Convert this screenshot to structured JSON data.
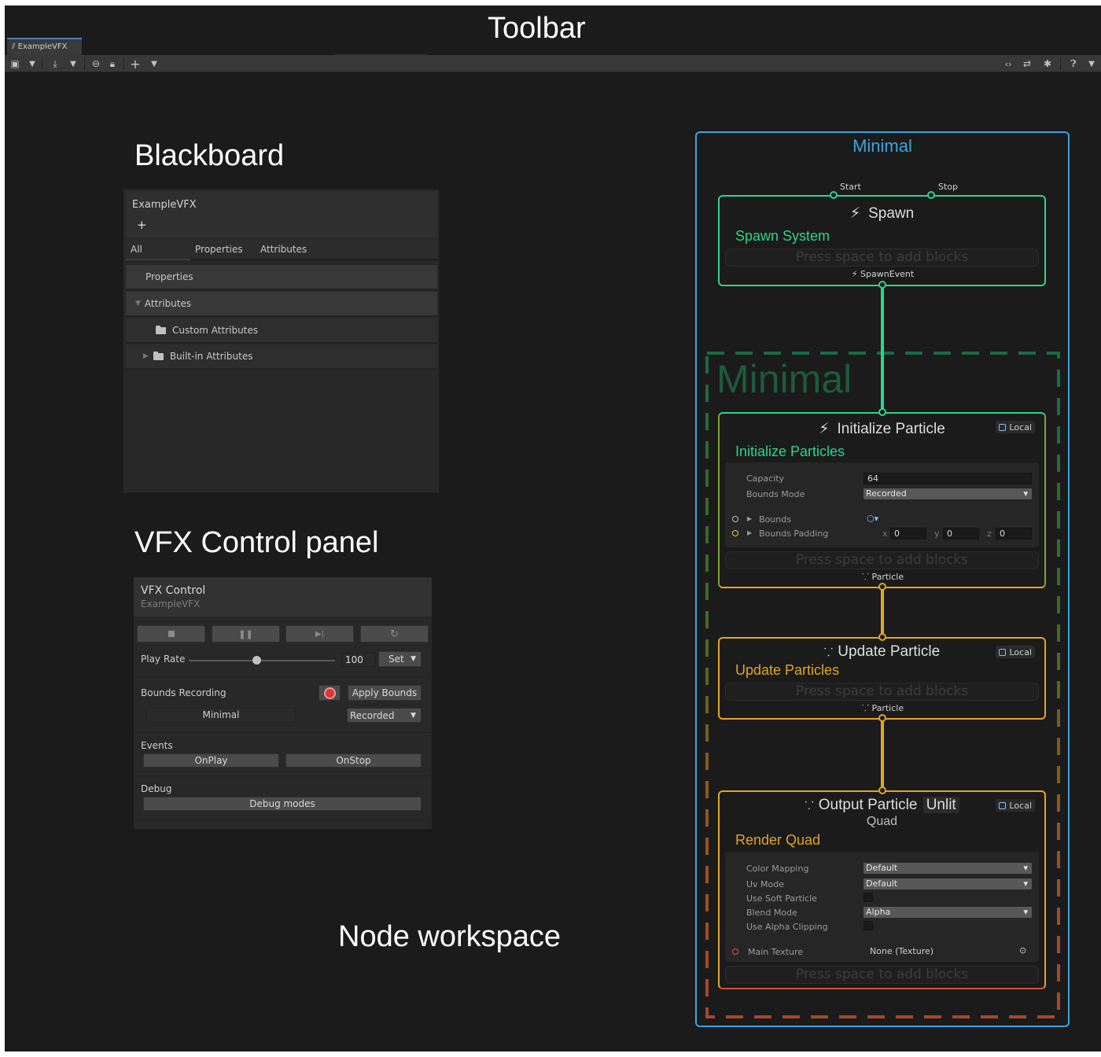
{
  "callouts": {
    "toolbar": "Toolbar",
    "blackboard": "Blackboard",
    "vfx_control": "VFX Control panel",
    "node_workspace": "Node workspace"
  },
  "window": {
    "tab_title": "ExampleVFX"
  },
  "toolbar_icons": [
    "save-icon",
    "dropdown-icon",
    "import-icon",
    "dropdown-icon",
    "link-icon",
    "lock-icon",
    "add-icon",
    "dropdown-icon",
    "code-toggle-icon",
    "compare-icon",
    "bug-icon",
    "help-icon",
    "menu-icon"
  ],
  "blackboard": {
    "title": "ExampleVFX",
    "add": "+",
    "tabs": [
      "All",
      "Properties",
      "Attributes"
    ],
    "rows": {
      "properties": "Properties",
      "attributes": "Attributes",
      "custom_attributes": "Custom Attributes",
      "builtin_attributes": "Built-in Attributes"
    }
  },
  "vfx_control": {
    "title": "VFX Control",
    "subtitle": "ExampleVFX",
    "transport": [
      "stop",
      "pause",
      "step",
      "restart"
    ],
    "play_rate_label": "Play Rate",
    "play_rate_value": "100",
    "play_rate_fraction": 0.46,
    "set_label": "Set",
    "bounds_recording_label": "Bounds Recording",
    "apply_bounds": "Apply Bounds",
    "system_name": "Minimal",
    "bounds_mode": "Recorded",
    "events_label": "Events",
    "events": [
      "OnPlay",
      "OnStop"
    ],
    "debug_label": "Debug",
    "debug_modes": "Debug modes"
  },
  "graph": {
    "system_title": "Minimal",
    "system_watermark": "Minimal",
    "press_space": "Press space to add blocks",
    "local_label": "Local",
    "colors": {
      "system_border": "#3ea4de",
      "spawn": "#2fd38b",
      "init": "#e0a628",
      "output": "#c9532d"
    },
    "spawn": {
      "title": "Spawn",
      "subtitle": "Spawn System",
      "start": "Start",
      "stop": "Stop",
      "flow_out": "SpawnEvent"
    },
    "initialize": {
      "title": "Initialize Particle",
      "subtitle": "Initialize Particles",
      "capacity_label": "Capacity",
      "capacity": "64",
      "bounds_mode_label": "Bounds Mode",
      "bounds_mode": "Recorded",
      "bounds_label": "Bounds",
      "bounds_padding_label": "Bounds Padding",
      "x_label": "x",
      "x": "0",
      "y_label": "y",
      "y": "0",
      "z_label": "z",
      "z": "0",
      "flow_out": "Particle"
    },
    "update": {
      "title": "Update Particle",
      "subtitle": "Update Particles",
      "flow_out": "Particle"
    },
    "output": {
      "title": "Output Particle",
      "title_tag": "Unlit",
      "title_line2": "Quad",
      "subtitle": "Render Quad",
      "color_mapping_label": "Color Mapping",
      "color_mapping": "Default",
      "uv_mode_label": "Uv Mode",
      "uv_mode": "Default",
      "soft_particle_label": "Use Soft Particle",
      "blend_mode_label": "Blend Mode",
      "blend_mode": "Alpha",
      "alpha_clipping_label": "Use Alpha Clipping",
      "main_texture_label": "Main Texture",
      "main_texture": "None (Texture)"
    }
  }
}
